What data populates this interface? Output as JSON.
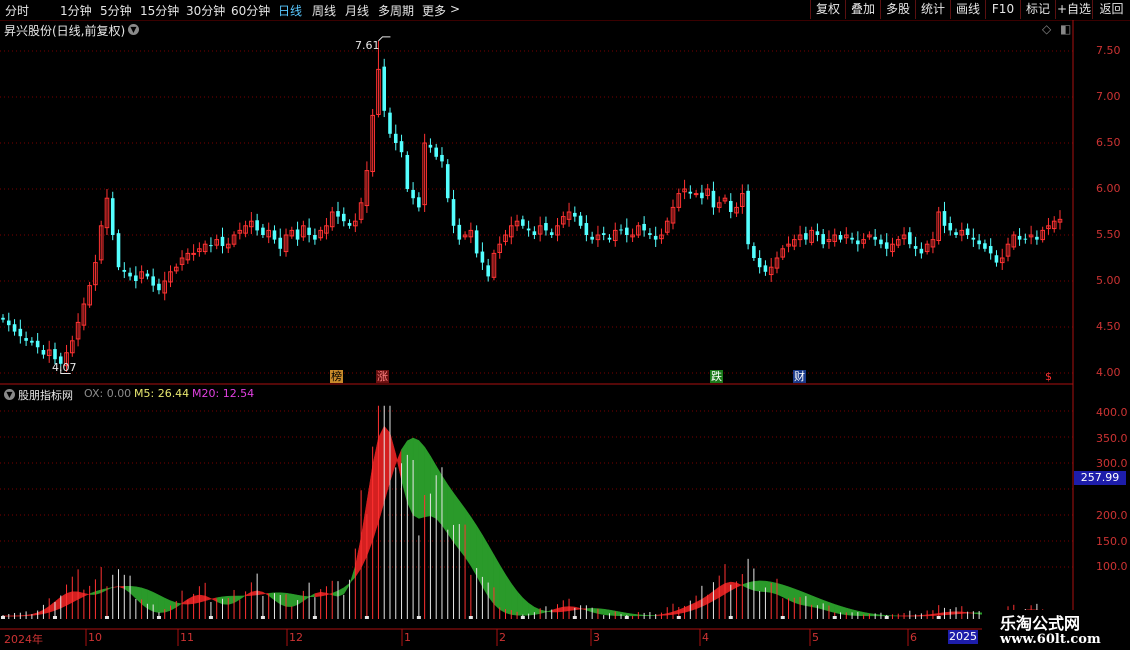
{
  "toolbar": {
    "periods": [
      "分时",
      "1分钟",
      "5分钟",
      "15分钟",
      "30分钟",
      "60分钟",
      "日线",
      "周线",
      "月线",
      "多周期",
      "更多"
    ],
    "more_arrow": ">",
    "buttons": [
      "复权",
      "叠加",
      "多股",
      "统计",
      "画线",
      "F10",
      "标记",
      "+自选",
      "返回"
    ]
  },
  "main_chart": {
    "title": "昇兴股份(日线,前复权)",
    "high_label": "7.61",
    "low_label": "4.07",
    "y_ticks": [
      "7.50",
      "7.00",
      "6.50",
      "6.00",
      "5.50",
      "5.00",
      "4.50",
      "4.00"
    ],
    "events": [
      "榜",
      "涨",
      "跌",
      "财",
      "$"
    ]
  },
  "indicator": {
    "name": "股朋指标网",
    "ox_label": "OX: 0.00",
    "m5_label": "M5: 26.44",
    "m20_label": "M20: 12.54",
    "y_ticks": [
      "400.0",
      "350.0",
      "300.0",
      "250.0",
      "200.0",
      "150.0",
      "100.0"
    ],
    "current_value": "257.99"
  },
  "x_axis": {
    "labels": [
      "2024年",
      "10",
      "11",
      "12",
      "1",
      "2",
      "3",
      "4",
      "5",
      "6"
    ],
    "year_badge": "2025"
  },
  "watermark": {
    "line1": "乐淘公式网",
    "line2": "www.60lt.com"
  },
  "colors": {
    "up": "#ff3232",
    "down": "#54ffff",
    "grid": "#7a0000",
    "fill_up": "#d42020",
    "fill_down": "#2a9a2a",
    "highlight": "#58c8ff"
  },
  "chart_data": {
    "type": "candlestick",
    "title": "昇兴股份(日线,前复权)",
    "y_range": [
      3.95,
      7.75
    ],
    "y_ticks": [
      4.0,
      4.5,
      5.0,
      5.5,
      6.0,
      6.5,
      7.0,
      7.5
    ],
    "close_series": [
      4.58,
      4.52,
      4.45,
      4.4,
      4.35,
      4.33,
      4.28,
      4.2,
      4.25,
      4.15,
      4.1,
      4.22,
      4.35,
      4.55,
      4.75,
      4.95,
      5.2,
      5.6,
      5.9,
      5.5,
      5.15,
      5.1,
      5.05,
      5.0,
      5.1,
      5.05,
      4.95,
      4.9,
      5.0,
      5.1,
      5.15,
      5.25,
      5.3,
      5.3,
      5.35,
      5.4,
      5.38,
      5.45,
      5.38,
      5.4,
      5.5,
      5.55,
      5.6,
      5.65,
      5.55,
      5.5,
      5.55,
      5.45,
      5.35,
      5.5,
      5.55,
      5.45,
      5.6,
      5.5,
      5.45,
      5.55,
      5.6,
      5.75,
      5.7,
      5.65,
      5.6,
      5.65,
      5.85,
      6.2,
      6.8,
      7.3,
      6.85,
      6.6,
      6.5,
      6.4,
      6.0,
      5.9,
      5.8,
      6.5,
      6.45,
      6.35,
      6.3,
      5.9,
      5.6,
      5.45,
      5.5,
      5.55,
      5.3,
      5.2,
      5.05,
      5.3,
      5.4,
      5.5,
      5.6,
      5.65,
      5.6,
      5.55,
      5.5,
      5.6,
      5.55,
      5.5,
      5.6,
      5.7,
      5.75,
      5.7,
      5.6,
      5.5,
      5.45,
      5.5,
      5.5,
      5.45,
      5.55,
      5.55,
      5.5,
      5.5,
      5.6,
      5.55,
      5.5,
      5.45,
      5.5,
      5.65,
      5.8,
      5.95,
      6.0,
      5.95,
      5.95,
      5.9,
      6.0,
      5.8,
      5.85,
      5.9,
      5.75,
      5.8,
      5.95,
      5.4,
      5.25,
      5.15,
      5.1,
      5.15,
      5.25,
      5.35,
      5.4,
      5.45,
      5.5,
      5.45,
      5.55,
      5.5,
      5.4,
      5.45,
      5.5,
      5.45,
      5.5,
      5.45,
      5.4,
      5.45,
      5.5,
      5.45,
      5.4,
      5.35,
      5.4,
      5.45,
      5.5,
      5.4,
      5.35,
      5.3,
      5.4,
      5.45,
      5.75,
      5.6,
      5.55,
      5.5,
      5.55,
      5.5,
      5.45,
      5.4,
      5.35,
      5.3,
      5.2,
      5.25,
      5.4,
      5.5,
      5.45,
      5.45,
      5.5,
      5.45,
      5.55,
      5.6,
      5.65,
      5.67
    ],
    "high_marker": 7.61,
    "low_marker": 4.07,
    "indicator": {
      "name": "股朋指标网",
      "series": [
        {
          "name": "OX",
          "last": 0.0
        },
        {
          "name": "M5",
          "last": 26.44
        },
        {
          "name": "M20",
          "last": 12.54
        }
      ],
      "y_range": [
        0,
        430
      ],
      "current": 257.99
    },
    "x_labels": [
      "2024年",
      "10",
      "11",
      "12",
      "1",
      "2",
      "3",
      "4",
      "5",
      "6",
      "2025"
    ]
  }
}
